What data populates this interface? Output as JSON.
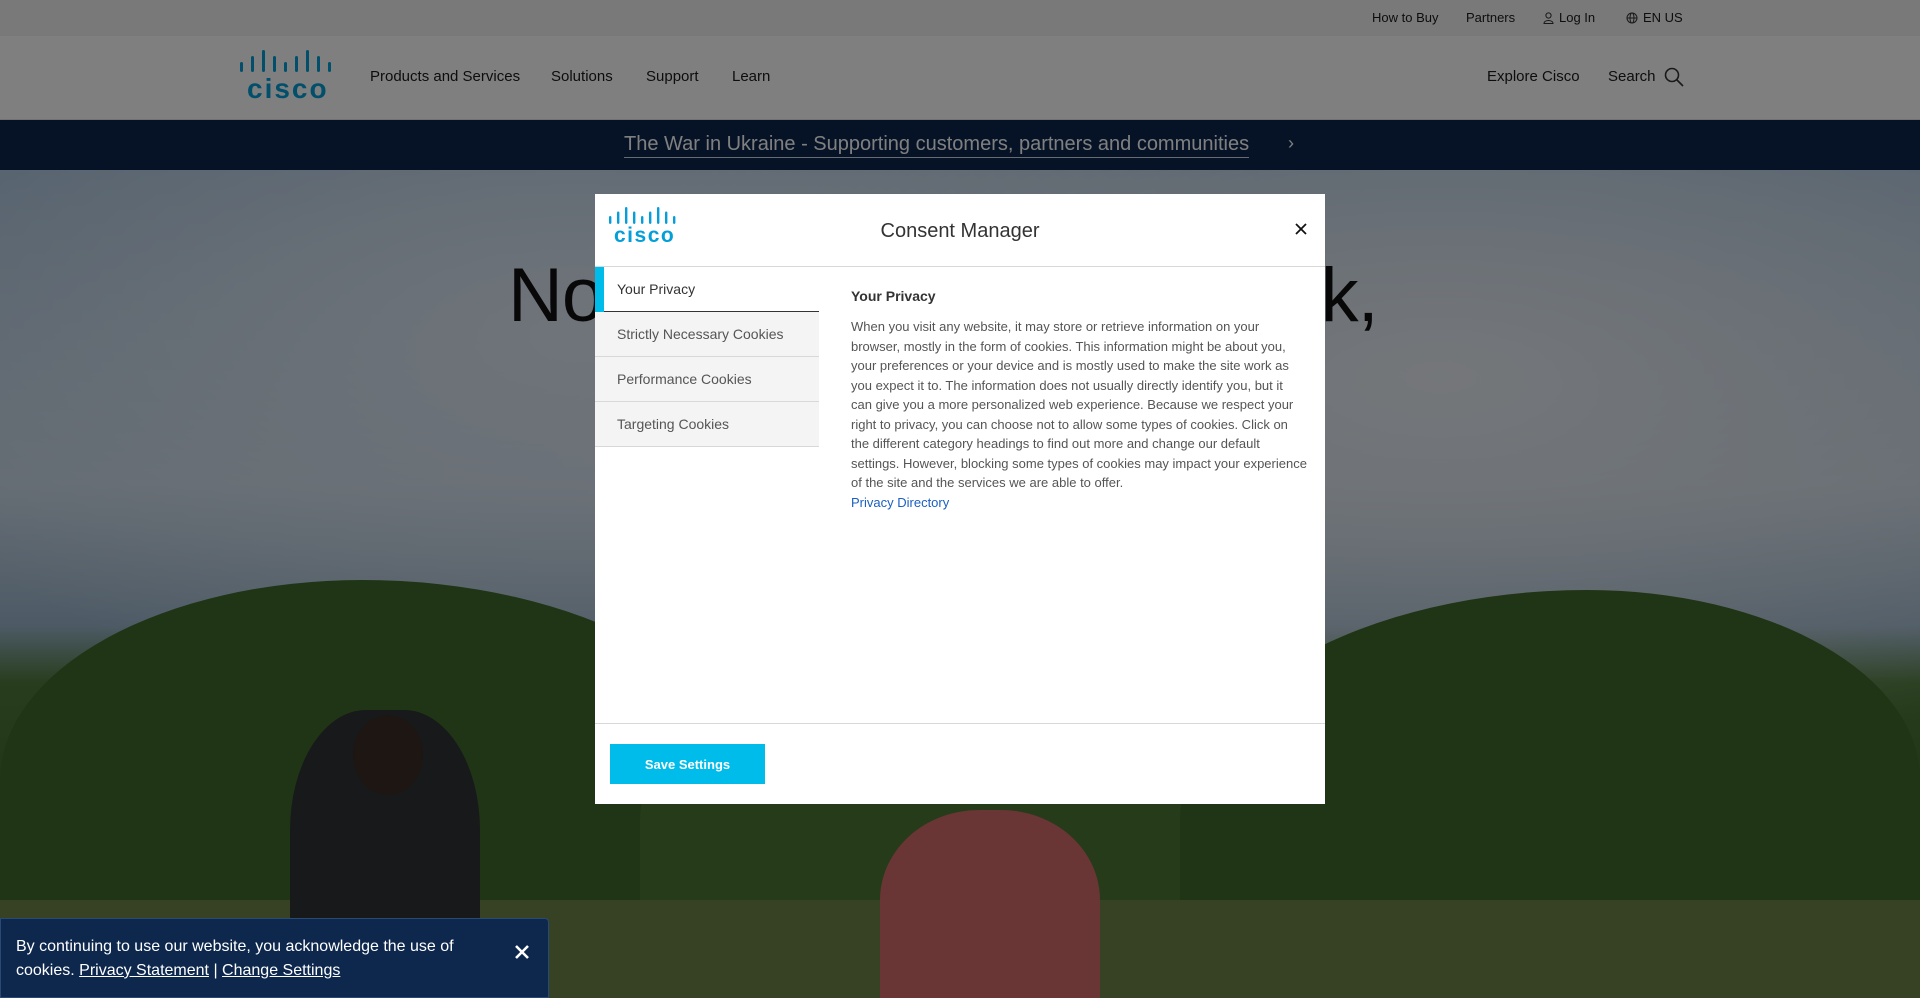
{
  "utility_bar": {
    "how_to_buy": "How to Buy",
    "partners": "Partners",
    "login": "Log In",
    "language": "EN US"
  },
  "brand": {
    "logo_text": "cisco"
  },
  "nav": {
    "items": [
      {
        "label": "Products and Services"
      },
      {
        "label": "Solutions"
      },
      {
        "label": "Support"
      },
      {
        "label": "Learn"
      }
    ],
    "explore": "Explore Cisco",
    "search": "Search"
  },
  "banner": {
    "text": "The War in Ukraine - Supporting customers, partners and communities",
    "chevron": "›"
  },
  "hero": {
    "title_left": "No",
    "title_right": "ork,"
  },
  "modal": {
    "title": "Consent Manager",
    "menu": [
      {
        "label": "Your Privacy",
        "active": true
      },
      {
        "label": "Strictly Necessary Cookies",
        "active": false
      },
      {
        "label": "Performance Cookies",
        "active": false
      },
      {
        "label": "Targeting Cookies",
        "active": false
      }
    ],
    "content": {
      "title": "Your Privacy",
      "text": "When you visit any website, it may store or retrieve information on your browser, mostly in the form of cookies. This information might be about you, your preferences or your device and is mostly used to make the site work as you expect it to. The information does not usually directly identify you, but it can give you a more personalized web experience. Because we respect your right to privacy, you can choose not to allow some types of cookies. Click on the different category headings to find out more and change our default settings. However, blocking some types of cookies may impact your experience of the site and the services we are able to offer.",
      "link": "Privacy Directory"
    },
    "save_button": "Save Settings"
  },
  "cookie_bar": {
    "text": "By continuing to use our website, you acknowledge the use of cookies.",
    "privacy_link": "Privacy Statement",
    "separator": "|",
    "settings_link": "Change Settings"
  },
  "colors": {
    "cisco_blue": "#049fd9",
    "accent": "#00bceb",
    "banner": "#0d274d",
    "link": "#1b5fc1"
  }
}
